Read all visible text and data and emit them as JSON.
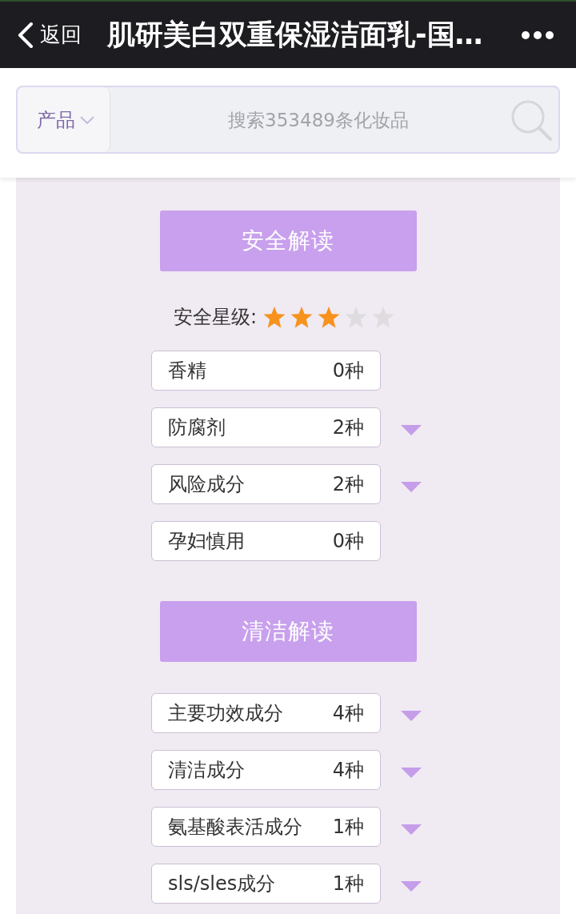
{
  "nav_bar": {
    "back_label": "返回",
    "title": "肌研美白双重保湿洁面乳-国…"
  },
  "search": {
    "category": "产品",
    "placeholder": "搜索353489条化妆品"
  },
  "sections": [
    {
      "title": "安全解读",
      "rating": {
        "label": "安全星级:",
        "stars": 3
      },
      "rows": [
        {
          "label": "香精",
          "count": "0种",
          "expandable": false
        },
        {
          "label": "防腐剂",
          "count": "2种",
          "expandable": true
        },
        {
          "label": "风险成分",
          "count": "2种",
          "expandable": true
        },
        {
          "label": "孕妇慎用",
          "count": "0种",
          "expandable": false
        }
      ]
    },
    {
      "title": "清洁解读",
      "rows": [
        {
          "label": "主要功效成分",
          "count": "4种",
          "expandable": true
        },
        {
          "label": "清洁成分",
          "count": "4种",
          "expandable": true
        },
        {
          "label": "氨基酸表活成分",
          "count": "1种",
          "expandable": true
        },
        {
          "label": "sls/sles成分",
          "count": "1种",
          "expandable": true
        }
      ]
    }
  ]
}
